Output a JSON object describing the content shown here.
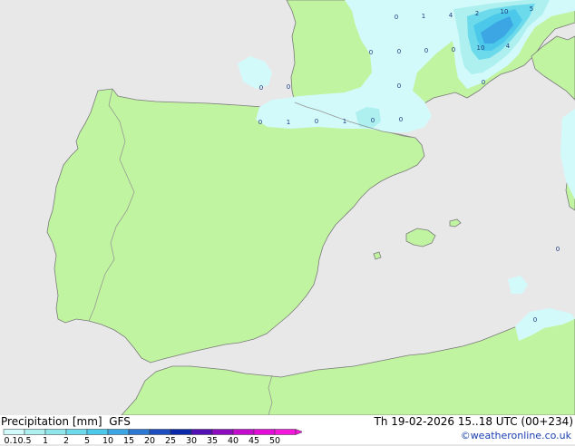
{
  "map": {
    "colors": {
      "sea": "#e8e8e8",
      "land": "#c0f4a0",
      "border": "#909090",
      "coast": "#7a7a7a"
    },
    "precip_labels": [
      "0",
      "1",
      "4",
      "2",
      "10",
      "5",
      "0",
      "0",
      "0",
      "0",
      "10",
      "4",
      "0",
      "0",
      "0",
      "0",
      "0",
      "1",
      "0",
      "1",
      "0",
      "0",
      "0",
      "0"
    ]
  },
  "footer": {
    "product": "Precipitation [mm]",
    "model": "GFS",
    "valid": "Th 19-02-2026 15..18 UTC (00+234)",
    "credit": "©weatheronline.co.uk",
    "legend": {
      "ticks": [
        "0.1",
        "0.5",
        "1",
        "2",
        "5",
        "10",
        "15",
        "20",
        "25",
        "30",
        "35",
        "40",
        "45",
        "50"
      ],
      "colors": [
        "#d2fafa",
        "#aef0f0",
        "#8ee6ea",
        "#6cdaea",
        "#4cc8ea",
        "#3ca6e4",
        "#2c78d2",
        "#1c4ec0",
        "#0c28aa",
        "#5010b4",
        "#8c0cc0",
        "#c40ccc",
        "#e40cd8",
        "#f418dc"
      ]
    }
  }
}
